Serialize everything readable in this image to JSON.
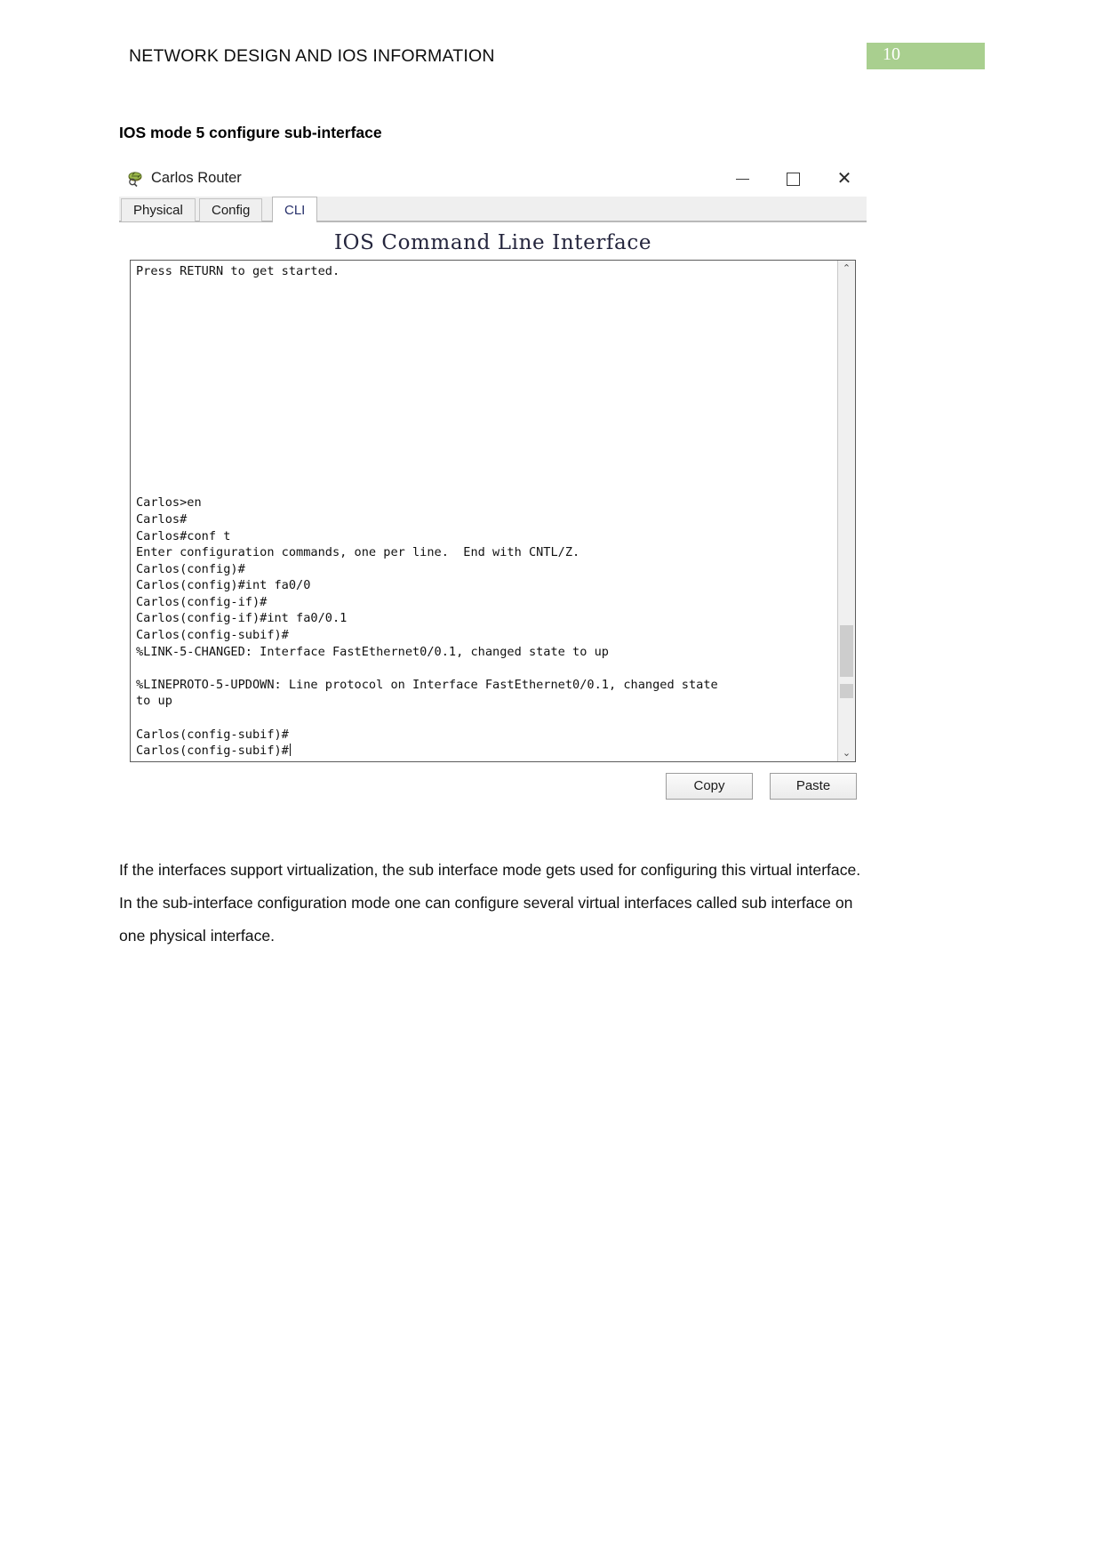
{
  "page": {
    "header_title": "NETWORK DESIGN AND IOS INFORMATION",
    "page_number": "10",
    "badge_color": "#a9cf8f",
    "section_heading": "IOS mode 5 configure sub-interface"
  },
  "window": {
    "title": "Carlos Router",
    "icon": "router-icon",
    "controls": {
      "minimize": "minimize-icon",
      "maximize": "maximize-icon",
      "close": "✕"
    },
    "tabs": [
      {
        "label": "Physical",
        "active": false
      },
      {
        "label": "Config",
        "active": false
      },
      {
        "label": "CLI",
        "active": true
      }
    ],
    "cli_heading": "IOS Command Line Interface",
    "terminal": {
      "lines": [
        "Press RETURN to get started.",
        "",
        "",
        "",
        "",
        "",
        "",
        "",
        "",
        "",
        "",
        "",
        "",
        "",
        "Carlos>en",
        "Carlos#",
        "Carlos#conf t",
        "Enter configuration commands, one per line.  End with CNTL/Z.",
        "Carlos(config)#",
        "Carlos(config)#int fa0/0",
        "Carlos(config-if)#",
        "Carlos(config-if)#int fa0/0.1",
        "Carlos(config-subif)#",
        "%LINK-5-CHANGED: Interface FastEthernet0/0.1, changed state to up",
        "",
        "%LINEPROTO-5-UPDOWN: Line protocol on Interface FastEthernet0/0.1, changed state",
        "to up",
        "",
        "Carlos(config-subif)#"
      ],
      "prompt_line": "Carlos(config-subif)#",
      "scroll_up_icon": "⌃",
      "scroll_down_icon": "⌄"
    },
    "buttons": {
      "copy": "Copy",
      "paste": "Paste"
    }
  },
  "body": {
    "paragraph": "If the interfaces support virtualization, the sub interface mode gets used for configuring this virtual interface. In the sub-interface configuration mode one can configure several virtual interfaces called sub interface on one physical interface."
  }
}
